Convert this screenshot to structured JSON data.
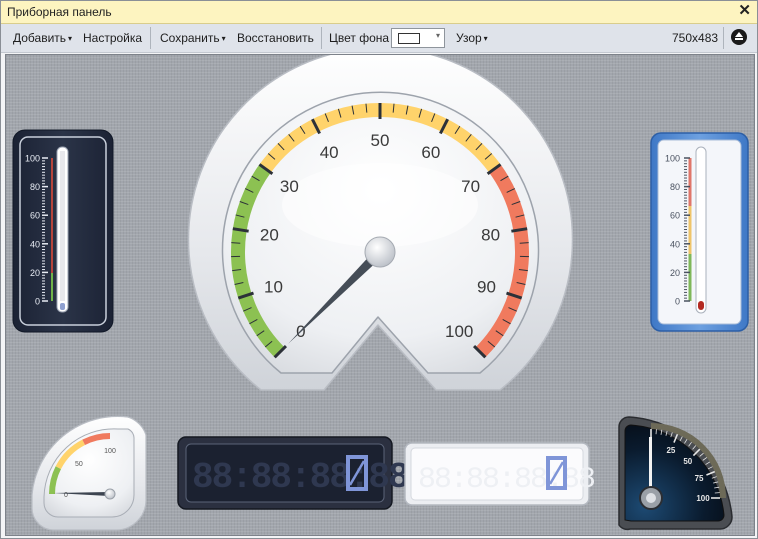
{
  "window": {
    "title": "Приборная панель",
    "close_glyph": "✕"
  },
  "toolbar": {
    "add_label": "Добавить",
    "settings_label": "Настройка",
    "save_label": "Сохранить",
    "restore_label": "Восстановить",
    "bgcolor_label": "Цвет фона",
    "bgcolor_value": "#ffffff",
    "pattern_label": "Узор",
    "size_label": "750x483",
    "dropdown_arrow": "▾",
    "eject_icon": "eject-icon"
  },
  "colors": {
    "green_zone": "#8cc152",
    "yellow_zone": "#ffd36b",
    "red_zone": "#f07a5e",
    "needle": "#454d57",
    "lcd_dark_bg": "#1e2433",
    "lcd_digit_active": "#7f95d8"
  },
  "main_gauge": {
    "min": 0,
    "max": 100,
    "value": 0,
    "labels": [
      "0",
      "10",
      "20",
      "30",
      "40",
      "50",
      "60",
      "70",
      "80",
      "90",
      "100"
    ],
    "zones": [
      {
        "from": 0,
        "to": 30,
        "color": "green"
      },
      {
        "from": 30,
        "to": 70,
        "color": "yellow"
      },
      {
        "from": 70,
        "to": 100,
        "color": "red"
      }
    ]
  },
  "thermometer_left": {
    "labels": [
      "100",
      "80",
      "60",
      "40",
      "20",
      "0"
    ],
    "value": 0
  },
  "thermometer_right": {
    "labels": [
      "100",
      "80",
      "60",
      "40",
      "20",
      "0"
    ],
    "value": 0
  },
  "small_gauge": {
    "labels": [
      "0",
      "50",
      "100"
    ],
    "value": 0
  },
  "lcd_dark": {
    "value": "0",
    "inactive_digits": "88:88:88:88"
  },
  "lcd_light": {
    "value": "0"
  },
  "black_gauge": {
    "labels": [
      "25",
      "50",
      "75",
      "100"
    ],
    "value": 0
  }
}
